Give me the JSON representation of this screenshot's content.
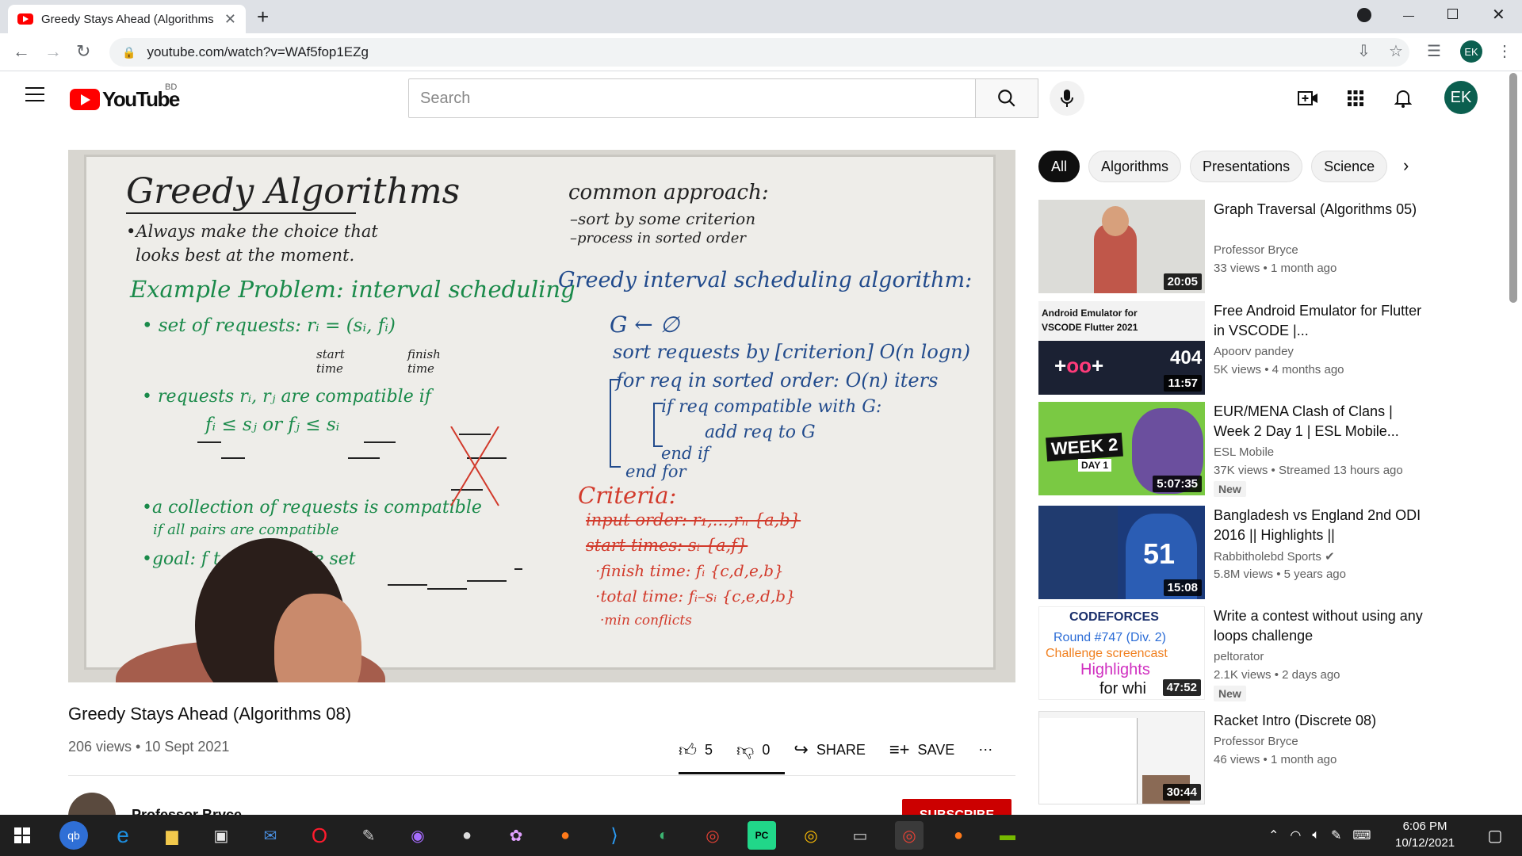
{
  "browser": {
    "tab_title": "Greedy Stays Ahead (Algorithms",
    "tab_close": "✕",
    "new_tab": "+",
    "url": "youtube.com/watch?v=WAf5fop1EZg",
    "profile_initials": "EK"
  },
  "header": {
    "logo_text": "YouTube",
    "country": "BD",
    "search_placeholder": "Search",
    "avatar_initials": "EK"
  },
  "video": {
    "title": "Greedy Stays Ahead (Algorithms 08)",
    "meta": "206 views • 10 Sept 2021",
    "likes": "5",
    "dislikes": "0",
    "share_label": "SHARE",
    "save_label": "SAVE",
    "more_label": "⋯",
    "channel_name": "Professor Bryce",
    "subscribe_label": "SUBSCRIBE"
  },
  "whiteboard": {
    "heading": "Greedy Algorithms",
    "line1": "•Always make the choice that",
    "line2": "looks best at the moment.",
    "common_approach": "common approach:",
    "ca1": "–sort by some criterion",
    "ca2": "–process in sorted order",
    "example": "Example Problem: interval scheduling",
    "set_requests": "• set of requests: rᵢ = (sᵢ, fᵢ)",
    "start_time": "start time",
    "finish_time": "finish time",
    "compatible": "• requests rᵢ, rⱼ are compatible if",
    "compat_cond": "fᵢ ≤ sⱼ   or   fⱼ ≤ sᵢ",
    "collection": "•a collection of requests is compatible",
    "collection2": "if all pairs are compatible",
    "goal": "•goal: f          t compatible set",
    "algo_title": "Greedy interval scheduling algorithm:",
    "a1": "G ← ∅",
    "a2": "sort requests by [criterion] O(n logn)",
    "a3": "for req in sorted order: O(n) iters",
    "a4": "if req compatible with G:",
    "a5": "add req to G",
    "a6": "end if",
    "a7": "end for",
    "criteria": "Criteria:",
    "c1": "input order: r₁,...,rₙ  {a,b}",
    "c2": "start times: sᵢ {a,f}",
    "c3": "·finish time: fᵢ  {c,d,e,b}",
    "c4": "·total time: fᵢ–sᵢ  {c,e,d,b}",
    "c5": "·min conflicts"
  },
  "chips": [
    "All",
    "Algorithms",
    "Presentations",
    "Science"
  ],
  "related": [
    {
      "title": "Graph Traversal (Algorithms 05)",
      "channel": "Professor Bryce",
      "meta": "33 views • 1 month ago",
      "duration": "20:05",
      "badge": ""
    },
    {
      "title": "Free Android Emulator for Flutter in VSCODE |...",
      "channel": "Apoorv pandey",
      "meta": "5K views • 4 months ago",
      "duration": "11:57",
      "badge": ""
    },
    {
      "title": "EUR/MENA Clash of Clans | Week 2 Day 1 | ESL Mobile...",
      "channel": "ESL Mobile",
      "meta": "37K views • Streamed 13 hours ago",
      "duration": "5:07:35",
      "badge": "New"
    },
    {
      "title": "Bangladesh vs England 2nd ODI 2016 || Highlights ||",
      "channel": "Rabbitholebd Sports ✔",
      "meta": "5.8M views • 5 years ago",
      "duration": "15:08",
      "badge": ""
    },
    {
      "title": "Write a contest without using any loops challenge",
      "channel": "peltorator",
      "meta": "2.1K views • 2 days ago",
      "duration": "47:52",
      "badge": "New"
    },
    {
      "title": "Racket Intro (Discrete 08)",
      "channel": "Professor Bryce",
      "meta": "46 views • 1 month ago",
      "duration": "30:44",
      "badge": ""
    }
  ],
  "thumb_text": {
    "android_line1": "Android Emulator for",
    "android_line2": "VSCODE Flutter 2021",
    "android_404": "404",
    "coc_week": "WEEK 2",
    "coc_day": "DAY 1",
    "cric_number": "51",
    "cf_logo": "CODEFORCES",
    "cf_round": "Round #747 (Div. 2)",
    "cf_line2": "Challenge screencast",
    "cf_line3": "Highlights",
    "cf_line4": "for whi"
  },
  "taskbar": {
    "time": "6:06 PM",
    "date": "10/12/2021"
  },
  "colors": {
    "brand_red": "#ff0000",
    "subscribe_red": "#cc0000",
    "avatar_green": "#0b5f4f"
  }
}
